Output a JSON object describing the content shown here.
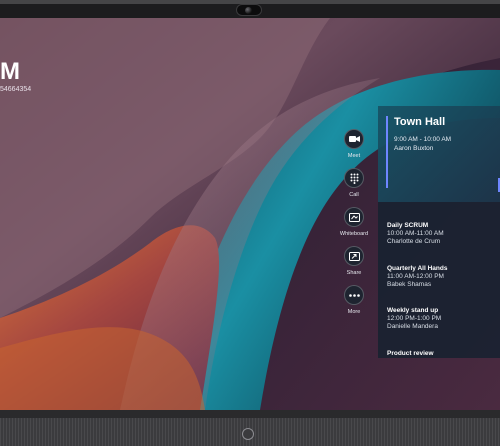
{
  "wallpaper": {
    "title": "M",
    "subtitle": "54664354"
  },
  "actions": [
    {
      "label": "Meet",
      "icon": "video-camera-icon"
    },
    {
      "label": "Call",
      "icon": "dialpad-icon"
    },
    {
      "label": "Whiteboard",
      "icon": "whiteboard-icon"
    },
    {
      "label": "Share",
      "icon": "share-screen-icon"
    },
    {
      "label": "More",
      "icon": "more-dots-icon"
    }
  ],
  "featured_meeting": {
    "title": "Town Hall",
    "time": "9:00 AM - 10:00 AM",
    "organizer": "Aaron Buxton"
  },
  "meetings": [
    {
      "title": "Daily SCRUM",
      "time": "10:00 AM-11:00 AM",
      "organizer": "Charlotte de Crum"
    },
    {
      "title": "Quarterly All Hands",
      "time": "11:00 AM-12:00 PM",
      "organizer": "Babek Shamas"
    },
    {
      "title": "Weekly stand up",
      "time": "12:00 PM-1:00 PM",
      "organizer": "Danielle Mandera"
    },
    {
      "title": "Product review",
      "time": "",
      "organizer": ""
    }
  ],
  "colors": {
    "accent": "#6e86ff",
    "panel": "#162230",
    "teal": "#18768c"
  }
}
